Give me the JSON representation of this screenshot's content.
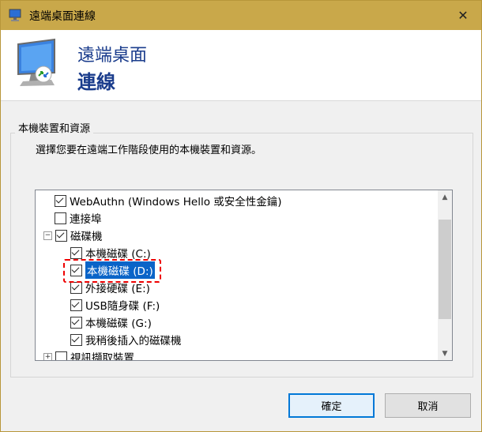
{
  "window": {
    "title": "遠端桌面連線",
    "close_label": "✕"
  },
  "banner": {
    "line1": "遠端桌面",
    "line2": "連線"
  },
  "group": {
    "label": "本機裝置和資源",
    "description": "選擇您要在遠端工作階段使用的本機裝置和資源。"
  },
  "tree": {
    "items": [
      {
        "label": "WebAuthn (Windows Hello 或安全性金鑰)",
        "checked": true
      },
      {
        "label": "連接埠",
        "checked": false
      },
      {
        "label": "磁碟機",
        "checked": true,
        "expander": "−"
      },
      {
        "label": "本機磁碟 (C:)",
        "checked": true
      },
      {
        "label": "本機磁碟 (D:)",
        "checked": true,
        "selected": true
      },
      {
        "label": "外接硬碟 (E:)",
        "checked": true
      },
      {
        "label": "USB隨身碟 (F:)",
        "checked": true
      },
      {
        "label": "本機磁碟 (G:)",
        "checked": true
      },
      {
        "label": "我稍後插入的磁碟機",
        "checked": true
      },
      {
        "label": "視訊擷取裝置",
        "checked": false,
        "expander": "+"
      }
    ]
  },
  "buttons": {
    "ok": "確定",
    "cancel": "取消"
  }
}
